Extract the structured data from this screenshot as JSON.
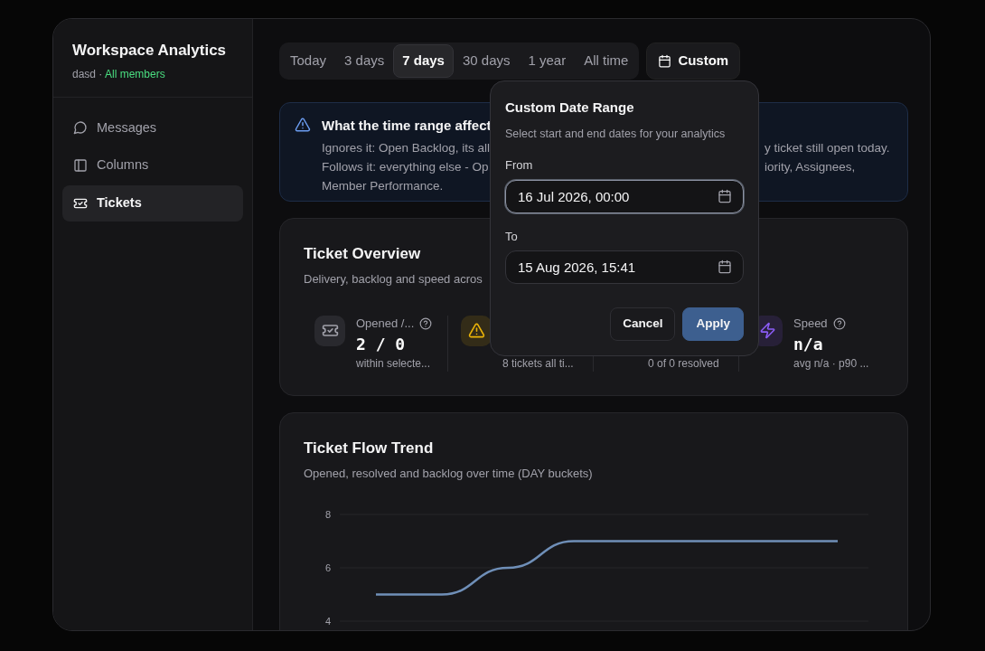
{
  "sidebar": {
    "title": "Workspace Analytics",
    "owner": "dasd",
    "separator": "·",
    "scope": "All members",
    "items": [
      {
        "label": "Messages",
        "selected": false
      },
      {
        "label": "Columns",
        "selected": false
      },
      {
        "label": "Tickets",
        "selected": true
      }
    ]
  },
  "range_tabs": [
    {
      "label": "Today",
      "selected": false
    },
    {
      "label": "3 days",
      "selected": false
    },
    {
      "label": "7 days",
      "selected": true
    },
    {
      "label": "30 days",
      "selected": false
    },
    {
      "label": "1 year",
      "selected": false
    },
    {
      "label": "All time",
      "selected": false
    }
  ],
  "custom_button": {
    "label": "Custom",
    "selected": false
  },
  "notice": {
    "title": "What the time range affect",
    "lines": [
      {
        "left": "Ignores it: Open Backlog, its all",
        "right": "y ticket still open today."
      },
      {
        "left": "Follows it: everything else - Op",
        "right": "iority, Assignees,"
      },
      {
        "left": "Member Performance."
      }
    ]
  },
  "overview": {
    "title": "Ticket Overview",
    "subtitle": "Delivery, backlog and speed acros",
    "stats": [
      {
        "label": "Opened /...",
        "help": true,
        "value": "2 / 0",
        "note": "within selecte...",
        "color": "#a1a1aa"
      },
      {
        "note": "8 tickets all ti...",
        "color": "#eab308"
      },
      {
        "note": "0 of 0 resolved"
      },
      {
        "label": "Speed",
        "help": true,
        "value": "n/a",
        "note": "avg n/a · p90 ...",
        "color": "#8b5cf6"
      }
    ]
  },
  "trend": {
    "title": "Ticket Flow Trend",
    "subtitle": "Opened, resolved and backlog over time (DAY buckets)",
    "chart_data": {
      "type": "line",
      "ylim": [
        4,
        8
      ],
      "yticks": [
        4,
        6,
        8
      ],
      "series": [
        {
          "color": "#6f8fb8",
          "values": [
            5,
            5,
            6,
            7,
            7,
            7,
            7,
            7
          ]
        }
      ]
    }
  },
  "popover": {
    "title": "Custom Date Range",
    "description": "Select start and end dates for your analytics",
    "fields": [
      {
        "label": "From",
        "value": "16 Jul 2026, 00:00",
        "focused": true
      },
      {
        "label": "To",
        "value": "15 Aug 2026, 15:41",
        "focused": false
      }
    ],
    "cancel": "Cancel",
    "apply": "Apply"
  }
}
